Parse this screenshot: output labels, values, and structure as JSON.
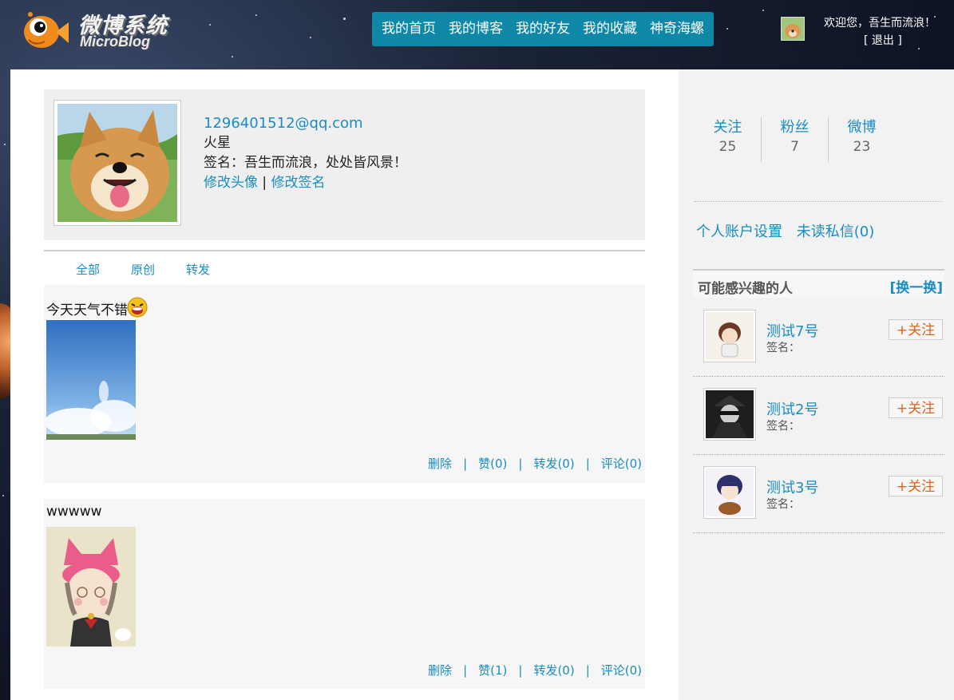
{
  "header": {
    "logo_cn": "微博系统",
    "logo_en": "MicroBlog",
    "nav": [
      "我的首页",
      "我的博客",
      "我的好友",
      "我的收藏",
      "神奇海螺"
    ],
    "welcome": "欢迎您，吾生而流浪！",
    "logout": "[ 退出 ]"
  },
  "profile": {
    "email": "1296401512@qq.com",
    "location": "火星",
    "signature": "签名：吾生而流浪，处处皆风景！",
    "edit_avatar": "修改头像",
    "separator": "|",
    "edit_signature": "修改签名"
  },
  "tabs": [
    "全部",
    "原创",
    "转发"
  ],
  "posts": [
    {
      "text": "今天天气不错",
      "actions": {
        "delete": "删除",
        "like": "赞(0)",
        "forward": "转发(0)",
        "comment": "评论(0)"
      }
    },
    {
      "text": "wwwww",
      "actions": {
        "delete": "删除",
        "like": "赞(1)",
        "forward": "转发(0)",
        "comment": "评论(0)"
      }
    }
  ],
  "sidebar": {
    "stats": [
      {
        "label": "关注",
        "value": "25"
      },
      {
        "label": "粉丝",
        "value": "7"
      },
      {
        "label": "微博",
        "value": "23"
      }
    ],
    "account_settings": "个人账户设置",
    "unread_messages": "未读私信(0)",
    "recommend_title": "可能感兴趣的人",
    "refresh": "[换一换]",
    "recommendations": [
      {
        "name": "测试7号",
        "sign": "签名：",
        "follow": "+关注"
      },
      {
        "name": "测试2号",
        "sign": "签名：",
        "follow": "+关注"
      },
      {
        "name": "测试3号",
        "sign": "签名：",
        "follow": "+关注"
      }
    ]
  },
  "colors": {
    "accent": "#1a8cc0",
    "nav_bg": "#0e88a6",
    "follow": "#e0601a"
  }
}
